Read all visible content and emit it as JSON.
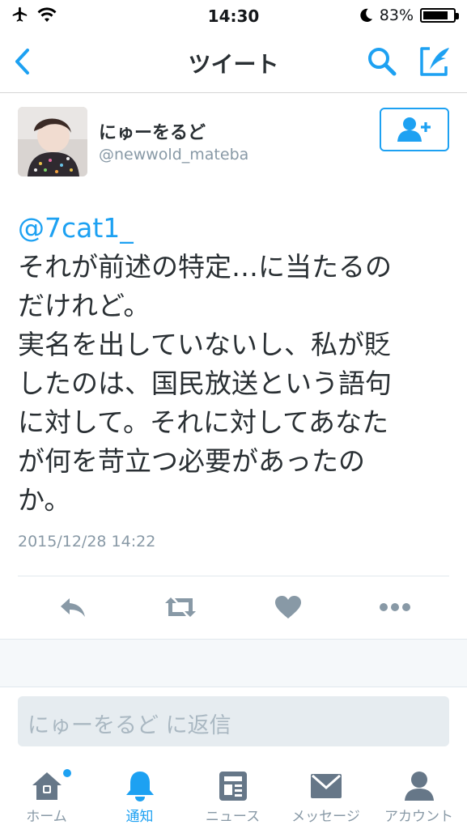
{
  "status_bar": {
    "time": "14:30",
    "battery_percent": "83%",
    "battery_level": 0.83
  },
  "nav": {
    "title": "ツイート",
    "back_icon": "chevron-left-icon",
    "search_icon": "search-icon",
    "compose_icon": "compose-icon"
  },
  "tweet": {
    "user_name": "にゅーをるど",
    "user_handle": "@newwold_mateba",
    "mention": "@7cat1_",
    "lines": [
      "それが前述の特定…に当たるの",
      "だけれど。",
      "実名を出していないし、私が貶",
      "したのは、国民放送という語句",
      "に対して。それに対してあなた",
      "が何を苛立つ必要があったの",
      "か。"
    ],
    "date": "2015/12/28 14:22"
  },
  "actions": [
    "reply-icon",
    "retweet-icon",
    "like-icon",
    "more-icon"
  ],
  "reply": {
    "placeholder": "にゅーをるど に返信"
  },
  "tabs": [
    {
      "label": "ホーム",
      "icon": "home-icon"
    },
    {
      "label": "通知",
      "icon": "bell-icon"
    },
    {
      "label": "ニュース",
      "icon": "news-icon"
    },
    {
      "label": "メッセージ",
      "icon": "message-icon"
    },
    {
      "label": "アカウント",
      "icon": "account-icon"
    }
  ],
  "colors": {
    "accent": "#1da1f2",
    "muted": "#8899a6",
    "text": "#292f33",
    "tab_icon": "#667788"
  }
}
